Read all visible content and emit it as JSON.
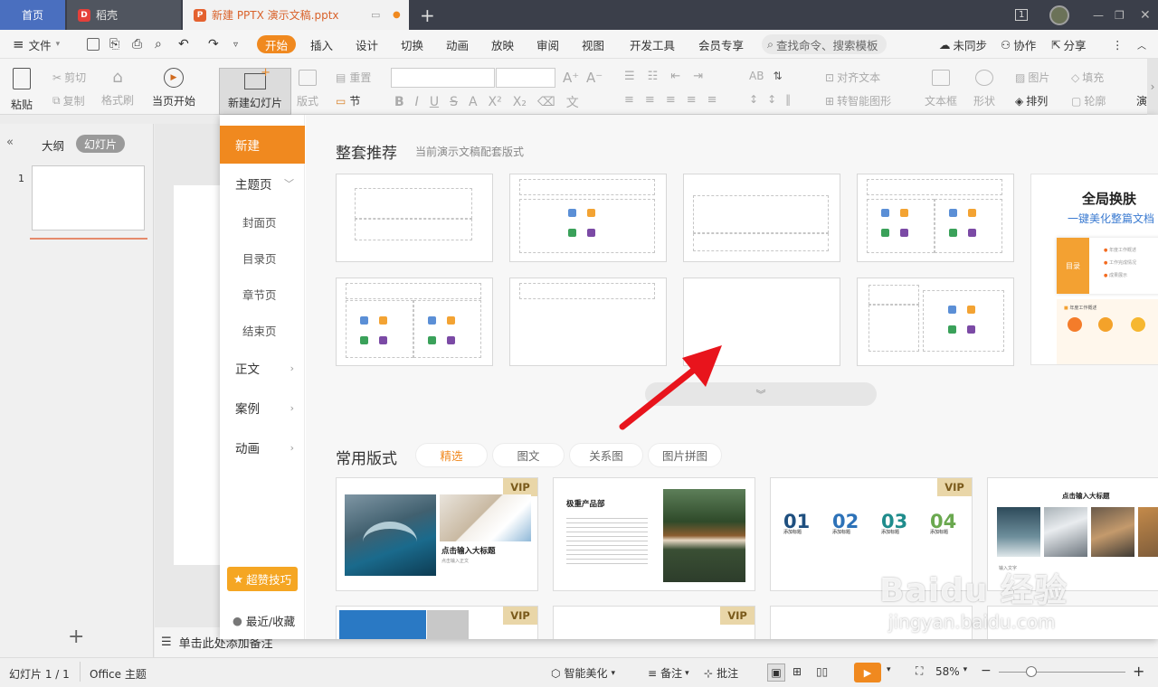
{
  "tabs": {
    "home": "首页",
    "docer": "稻壳",
    "doc": "新建 PPTX 演示文稿.pptx"
  },
  "window": {
    "badge": "1"
  },
  "menu": {
    "file": "文件",
    "items": [
      "开始",
      "插入",
      "设计",
      "切换",
      "动画",
      "放映",
      "审阅",
      "视图",
      "开发工具",
      "会员专享"
    ],
    "search": "查找命令、搜索模板",
    "sync": "未同步",
    "collab": "协作",
    "share": "分享"
  },
  "ribbon": {
    "paste": "粘贴",
    "cut": "剪切",
    "copy": "复制",
    "format_painter": "格式刷",
    "play_from_current": "当页开始",
    "new_slide": "新建幻灯片",
    "layout": "版式",
    "section": "节",
    "reset": "重置",
    "text_dir": "对齐文本",
    "smartart": "转智能图形",
    "textbox": "文本框",
    "shape": "形状",
    "arrange": "排列",
    "picture": "图片",
    "fill": "填充",
    "outline": "轮廓",
    "more": "演"
  },
  "leftpane": {
    "outline": "大纲",
    "slides": "幻灯片",
    "slide_num": "1"
  },
  "notes": "单击此处添加备注",
  "panel": {
    "nav": {
      "new": "新建",
      "theme": "主题页",
      "cover": "封面页",
      "toc": "目录页",
      "chapter": "章节页",
      "end": "结束页",
      "body": "正文",
      "case": "案例",
      "anim": "动画",
      "tips": "超赞技巧",
      "recent": "最近/收藏"
    },
    "recommend_title": "整套推荐",
    "recommend_sub": "当前演示文稿配套版式",
    "promo_title": "全局换肤",
    "promo_sub": "一键美化整篇文档",
    "promo_item1": "年度工作概述",
    "promo_item2": "工作完成情况",
    "promo_item3": "成果展示",
    "promo_label": "目录",
    "common_title": "常用版式",
    "filters": [
      "精选",
      "图文",
      "关系图",
      "图片拼图"
    ],
    "vip": "VIP",
    "card1_title": "点击输入大标题",
    "card1_sub": "点击输入正文",
    "card2_title": "极重产品部",
    "card3_nums": [
      "01",
      "02",
      "03",
      "04"
    ],
    "card3_label": "添加标题",
    "card4_title": "点击输入大标题",
    "card4_sub": "输入文字"
  },
  "status": {
    "slide": "幻灯片 1 / 1",
    "theme": "Office 主题",
    "beautify": "智能美化",
    "notes": "备注",
    "comment": "批注",
    "zoom": "58%"
  },
  "watermark": {
    "brand": "Baidu 经验",
    "url": "jingyan.baidu.com"
  },
  "colors": {
    "accent": "#f0891f",
    "orange_tab": "#d9622b",
    "arrow": "#e8141c"
  }
}
